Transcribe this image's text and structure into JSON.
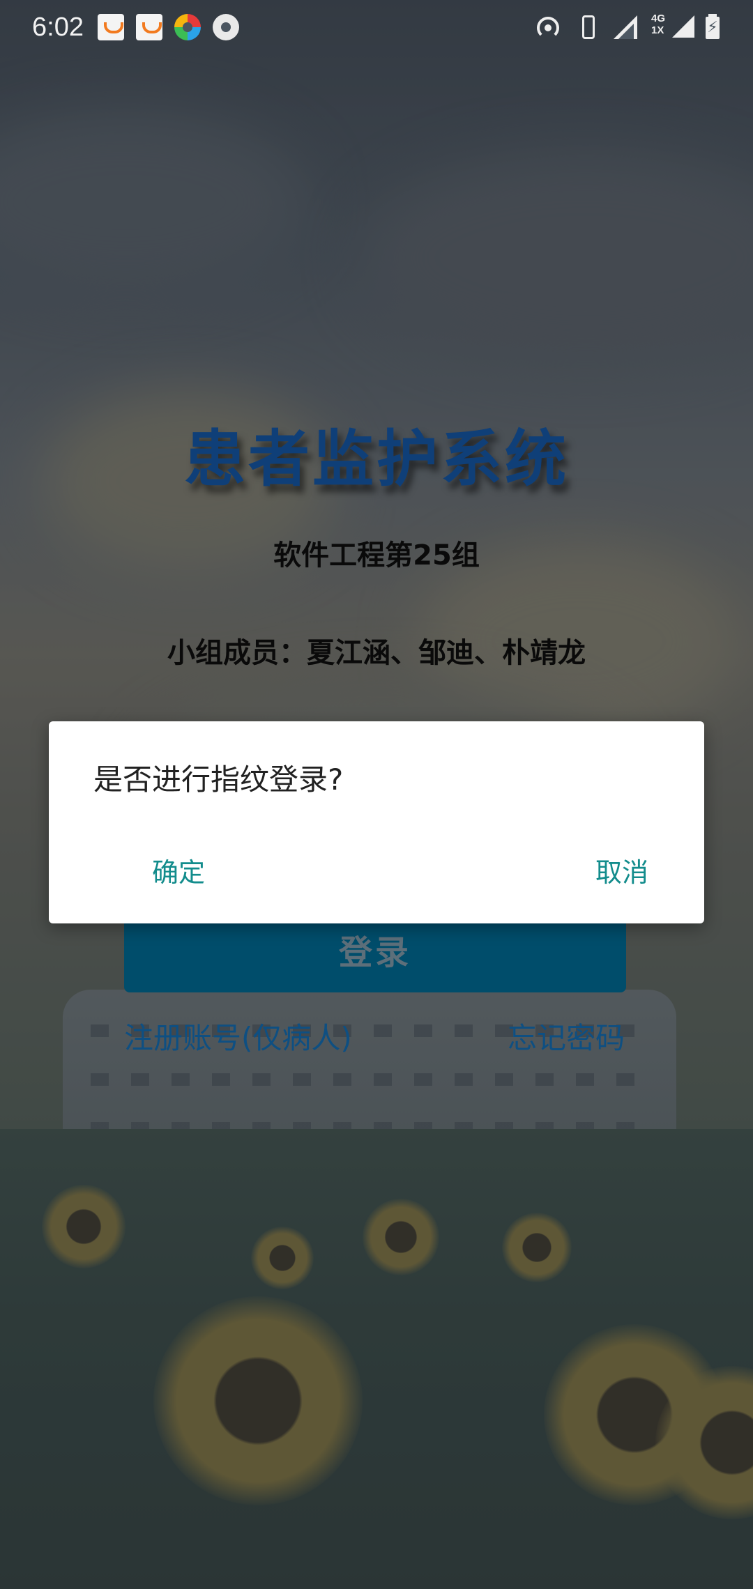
{
  "status_bar": {
    "time": "6:02",
    "network_type_top": "4G",
    "network_type_bottom": "1X",
    "battery_charging_glyph": "charging-bolt-icon",
    "notification_icons": [
      "didi-icon",
      "didi-icon",
      "pinwheel-icon",
      "aperture-icon"
    ],
    "system_icons": [
      "hotspot-icon",
      "vibrate-icon",
      "signal-icon",
      "data-arrows-icon",
      "signal-icon",
      "battery-icon"
    ]
  },
  "app": {
    "title": "患者监护系统",
    "subtitle": "软件工程第25组",
    "members": "小组成员：夏江涵、邹迪、朴靖龙"
  },
  "login": {
    "login_label": "登录",
    "register_label": "注册账号(仅病人)",
    "forgot_label": "忘记密码"
  },
  "dialog": {
    "message": "是否进行指纹登录?",
    "confirm_label": "确定",
    "cancel_label": "取消"
  },
  "colors": {
    "title": "#0f3f78",
    "login_button": "#004d6b",
    "link": "#0e4f82",
    "dialog_action": "#128c8c",
    "dialog_bg": "#ffffff"
  }
}
